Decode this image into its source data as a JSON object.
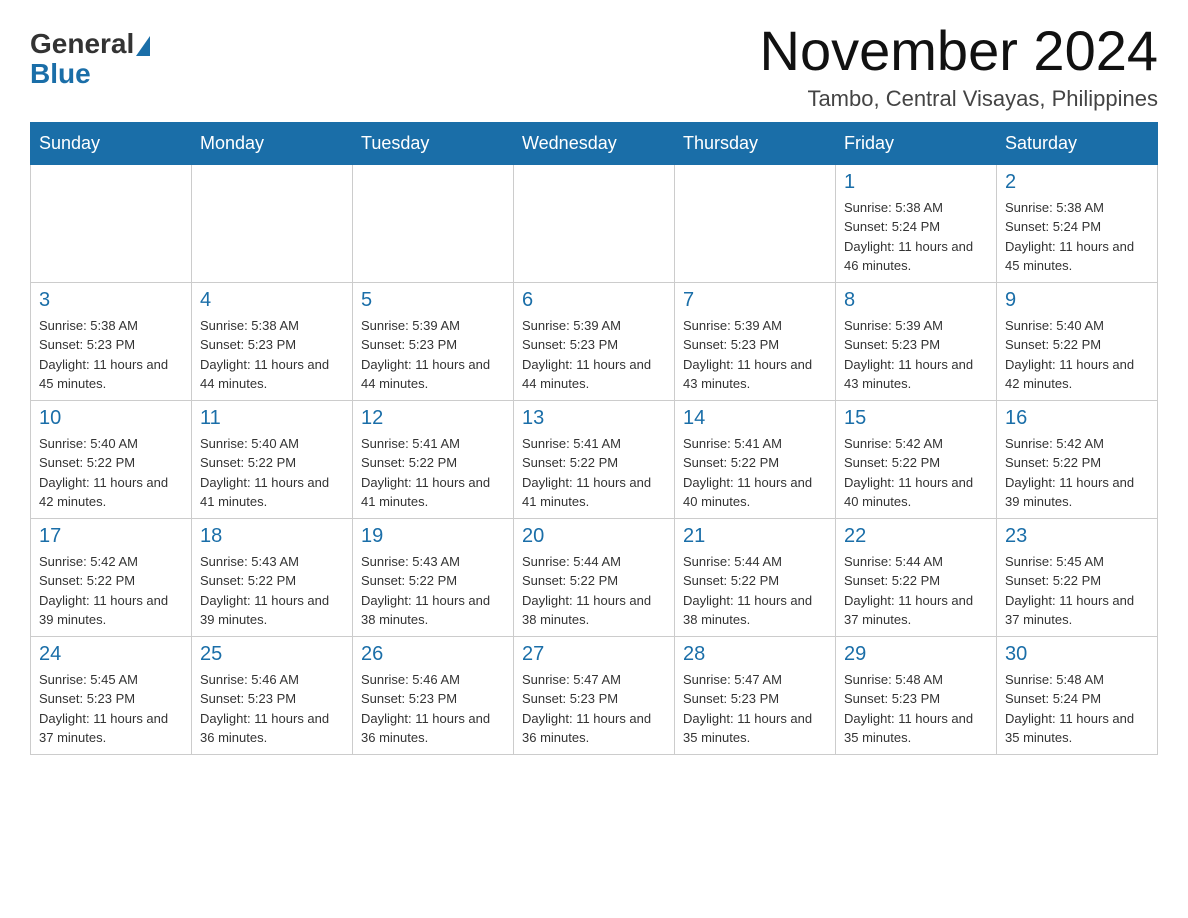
{
  "header": {
    "logo": {
      "general": "General",
      "blue": "Blue"
    },
    "title": "November 2024",
    "location": "Tambo, Central Visayas, Philippines"
  },
  "calendar": {
    "days_of_week": [
      "Sunday",
      "Monday",
      "Tuesday",
      "Wednesday",
      "Thursday",
      "Friday",
      "Saturday"
    ],
    "weeks": [
      [
        {
          "day": "",
          "info": ""
        },
        {
          "day": "",
          "info": ""
        },
        {
          "day": "",
          "info": ""
        },
        {
          "day": "",
          "info": ""
        },
        {
          "day": "",
          "info": ""
        },
        {
          "day": "1",
          "info": "Sunrise: 5:38 AM\nSunset: 5:24 PM\nDaylight: 11 hours and 46 minutes."
        },
        {
          "day": "2",
          "info": "Sunrise: 5:38 AM\nSunset: 5:24 PM\nDaylight: 11 hours and 45 minutes."
        }
      ],
      [
        {
          "day": "3",
          "info": "Sunrise: 5:38 AM\nSunset: 5:23 PM\nDaylight: 11 hours and 45 minutes."
        },
        {
          "day": "4",
          "info": "Sunrise: 5:38 AM\nSunset: 5:23 PM\nDaylight: 11 hours and 44 minutes."
        },
        {
          "day": "5",
          "info": "Sunrise: 5:39 AM\nSunset: 5:23 PM\nDaylight: 11 hours and 44 minutes."
        },
        {
          "day": "6",
          "info": "Sunrise: 5:39 AM\nSunset: 5:23 PM\nDaylight: 11 hours and 44 minutes."
        },
        {
          "day": "7",
          "info": "Sunrise: 5:39 AM\nSunset: 5:23 PM\nDaylight: 11 hours and 43 minutes."
        },
        {
          "day": "8",
          "info": "Sunrise: 5:39 AM\nSunset: 5:23 PM\nDaylight: 11 hours and 43 minutes."
        },
        {
          "day": "9",
          "info": "Sunrise: 5:40 AM\nSunset: 5:22 PM\nDaylight: 11 hours and 42 minutes."
        }
      ],
      [
        {
          "day": "10",
          "info": "Sunrise: 5:40 AM\nSunset: 5:22 PM\nDaylight: 11 hours and 42 minutes."
        },
        {
          "day": "11",
          "info": "Sunrise: 5:40 AM\nSunset: 5:22 PM\nDaylight: 11 hours and 41 minutes."
        },
        {
          "day": "12",
          "info": "Sunrise: 5:41 AM\nSunset: 5:22 PM\nDaylight: 11 hours and 41 minutes."
        },
        {
          "day": "13",
          "info": "Sunrise: 5:41 AM\nSunset: 5:22 PM\nDaylight: 11 hours and 41 minutes."
        },
        {
          "day": "14",
          "info": "Sunrise: 5:41 AM\nSunset: 5:22 PM\nDaylight: 11 hours and 40 minutes."
        },
        {
          "day": "15",
          "info": "Sunrise: 5:42 AM\nSunset: 5:22 PM\nDaylight: 11 hours and 40 minutes."
        },
        {
          "day": "16",
          "info": "Sunrise: 5:42 AM\nSunset: 5:22 PM\nDaylight: 11 hours and 39 minutes."
        }
      ],
      [
        {
          "day": "17",
          "info": "Sunrise: 5:42 AM\nSunset: 5:22 PM\nDaylight: 11 hours and 39 minutes."
        },
        {
          "day": "18",
          "info": "Sunrise: 5:43 AM\nSunset: 5:22 PM\nDaylight: 11 hours and 39 minutes."
        },
        {
          "day": "19",
          "info": "Sunrise: 5:43 AM\nSunset: 5:22 PM\nDaylight: 11 hours and 38 minutes."
        },
        {
          "day": "20",
          "info": "Sunrise: 5:44 AM\nSunset: 5:22 PM\nDaylight: 11 hours and 38 minutes."
        },
        {
          "day": "21",
          "info": "Sunrise: 5:44 AM\nSunset: 5:22 PM\nDaylight: 11 hours and 38 minutes."
        },
        {
          "day": "22",
          "info": "Sunrise: 5:44 AM\nSunset: 5:22 PM\nDaylight: 11 hours and 37 minutes."
        },
        {
          "day": "23",
          "info": "Sunrise: 5:45 AM\nSunset: 5:22 PM\nDaylight: 11 hours and 37 minutes."
        }
      ],
      [
        {
          "day": "24",
          "info": "Sunrise: 5:45 AM\nSunset: 5:23 PM\nDaylight: 11 hours and 37 minutes."
        },
        {
          "day": "25",
          "info": "Sunrise: 5:46 AM\nSunset: 5:23 PM\nDaylight: 11 hours and 36 minutes."
        },
        {
          "day": "26",
          "info": "Sunrise: 5:46 AM\nSunset: 5:23 PM\nDaylight: 11 hours and 36 minutes."
        },
        {
          "day": "27",
          "info": "Sunrise: 5:47 AM\nSunset: 5:23 PM\nDaylight: 11 hours and 36 minutes."
        },
        {
          "day": "28",
          "info": "Sunrise: 5:47 AM\nSunset: 5:23 PM\nDaylight: 11 hours and 35 minutes."
        },
        {
          "day": "29",
          "info": "Sunrise: 5:48 AM\nSunset: 5:23 PM\nDaylight: 11 hours and 35 minutes."
        },
        {
          "day": "30",
          "info": "Sunrise: 5:48 AM\nSunset: 5:24 PM\nDaylight: 11 hours and 35 minutes."
        }
      ]
    ]
  }
}
